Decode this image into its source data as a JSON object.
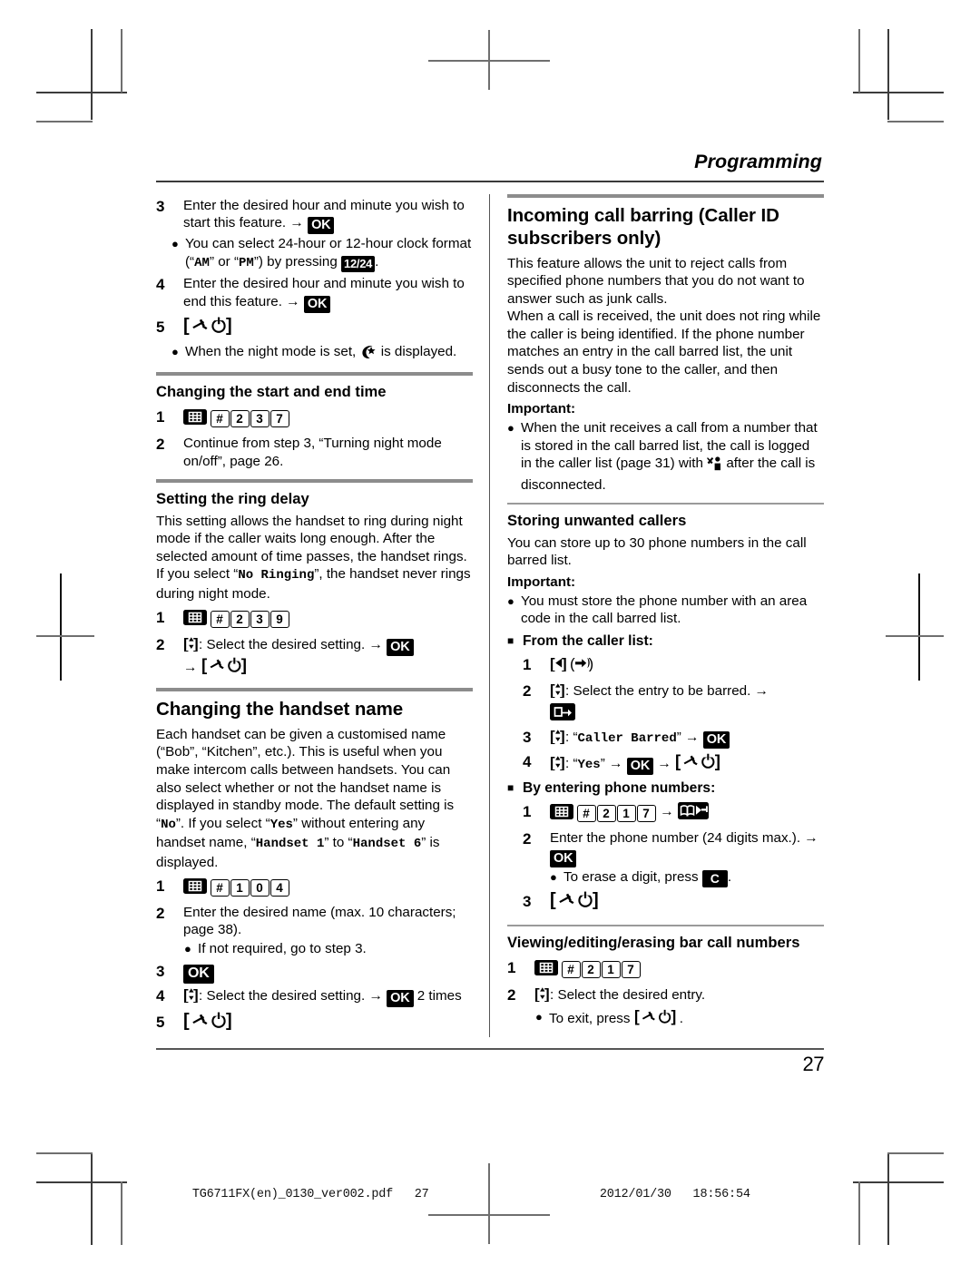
{
  "running_head": "Programming",
  "page_number": "27",
  "footer": {
    "file": "TG6711FX(en)_0130_ver002.pdf",
    "file_page": "27",
    "date": "2012/01/30",
    "time": "18:56:54"
  },
  "left_column": {
    "steps_top": [
      {
        "num": "3",
        "text": "Enter the desired hour and minute you wish to start this feature.",
        "arrow": "→",
        "key": "OK"
      },
      {
        "num": "4",
        "text": "Enter the desired hour and minute you wish to end this feature.",
        "arrow": "→",
        "key": "OK"
      }
    ],
    "bullet_12_24": {
      "part1": "You can select 24-hour or 12-hour clock format (“",
      "am": "AM",
      "mid": "” or “",
      "pm": "PM",
      "part2": "”) by pressing ",
      "key": "12/24",
      "end": "."
    },
    "step5_num": "5",
    "step5_key": "[off-power]",
    "bullet_night_mode": {
      "before": "When the night mode is set, ",
      "icon": "moon-star-icon",
      "after": " is displayed."
    },
    "section_start_end": {
      "title": "Changing the start and end time",
      "step1": {
        "num": "1",
        "menu_icon": "menu-key-icon",
        "keys": [
          "#",
          "2",
          "3",
          "7"
        ]
      },
      "step2": {
        "num": "2",
        "text": "Continue from step 3, “Turning night mode on/off”, page 26."
      }
    },
    "section_ring_delay": {
      "title": "Setting the ring delay",
      "body_part1": "This setting allows the handset to ring during night mode if the caller waits long enough. After the selected amount of time passes, the handset rings. If you select “",
      "body_mono": "No Ringing",
      "body_part2": "”, the handset never rings during night mode.",
      "step1": {
        "num": "1",
        "menu_icon": "menu-key-icon",
        "keys": [
          "#",
          "2",
          "3",
          "9"
        ]
      },
      "step2": {
        "num": "2",
        "nav": "[nav-updown]",
        "text": ": Select the desired setting.",
        "arrow": "→",
        "key": "OK",
        "arrow2": "→",
        "end_key": "[off-power]"
      }
    },
    "section_handset_name": {
      "title": "Changing the handset name",
      "body_part1": "Each handset can be given a customised name (“Bob”, “Kitchen”, etc.). This is useful when you make intercom calls between handsets. You can also select whether or not the handset name is displayed in standby mode. The default setting is “",
      "body_no": "No",
      "body_part2": "”. If you select “",
      "body_yes": "Yes",
      "body_part3": "” without entering any handset name, “",
      "body_hs1": "Handset 1",
      "body_part4": "” to “",
      "body_hs6": "Handset 6",
      "body_part5": "” is displayed.",
      "step1": {
        "num": "1",
        "menu_icon": "menu-key-icon",
        "keys": [
          "#",
          "1",
          "0",
          "4"
        ]
      },
      "step2": {
        "num": "2",
        "text": "Enter the desired name (max. 10 characters; page 38)."
      },
      "step2_bullet": "If not required, go to step 3.",
      "step3": {
        "num": "3",
        "key": "OK"
      },
      "step4": {
        "num": "4",
        "nav": "[nav-updown]",
        "text": ": Select the desired setting.",
        "arrow": "→",
        "key": "OK",
        "suffix": " 2 times"
      },
      "step5": {
        "num": "5",
        "key": "[off-power]"
      }
    }
  },
  "right_column": {
    "section_barring": {
      "title": "Incoming call barring (Caller ID subscribers only)",
      "body": "This feature allows the unit to reject calls from specified phone numbers that you do not want to answer such as junk calls.\nWhen a call is received, the unit does not ring while the caller is being identified. If the phone number matches an entry in the call barred list, the unit sends out a busy tone to the caller, and then disconnects the call.",
      "important_label": "Important:",
      "important_bullet": {
        "part1": "When the unit receives a call from a number that is stored in the call barred list, the call is logged in the caller list (page 31) with ",
        "icon": "barred-caller-icon",
        "part2": " after the call is disconnected."
      }
    },
    "section_storing": {
      "title": "Storing unwanted callers",
      "body": "You can store up to 30 phone numbers in the call barred list.",
      "important_label": "Important:",
      "important_bullet": "You must store the phone number with an area code in the call barred list.",
      "group_caller_list": {
        "heading": "From the caller list:",
        "step1": {
          "num": "1",
          "key_left": "[◀]",
          "key_paren": "(caller-list-icon)"
        },
        "step2": {
          "num": "2",
          "nav": "[nav-updown]",
          "text": ": Select the entry to be barred.",
          "arrow": "→",
          "icon": "erase-key-icon"
        },
        "step3": {
          "num": "3",
          "nav": "[nav-updown]",
          "colon": ": “",
          "mono": "Caller Barred",
          "close": "”",
          "arrow": "→",
          "key": "OK"
        },
        "step4": {
          "num": "4",
          "nav": "[nav-updown]",
          "colon": ": “",
          "mono": "Yes",
          "close": "”",
          "arrow": "→",
          "key": "OK",
          "arrow2": "→",
          "end_key": "[off-power]"
        }
      },
      "group_entering": {
        "heading": "By entering phone numbers:",
        "step1": {
          "num": "1",
          "menu_icon": "menu-key-icon",
          "keys": [
            "#",
            "2",
            "1",
            "7"
          ],
          "arrow": "→",
          "icon": "phonebook-arrow-icon"
        },
        "step2": {
          "num": "2",
          "text": "Enter the phone number (24 digits max.).",
          "arrow": "→",
          "key": "OK"
        },
        "step2_bullet": {
          "part1": "To erase a digit, press ",
          "key": "C",
          "part2": "."
        },
        "step3": {
          "num": "3",
          "key": "[off-power]"
        }
      }
    },
    "section_viewing": {
      "title": "Viewing/editing/erasing bar call numbers",
      "step1": {
        "num": "1",
        "menu_icon": "menu-key-icon",
        "keys": [
          "#",
          "2",
          "1",
          "7"
        ]
      },
      "step2": {
        "num": "2",
        "nav": "[nav-updown]",
        "text": ": Select the desired entry."
      },
      "step2_bullet": {
        "part1": "To exit, press ",
        "key": "[off-power]",
        "part2": "."
      }
    }
  }
}
